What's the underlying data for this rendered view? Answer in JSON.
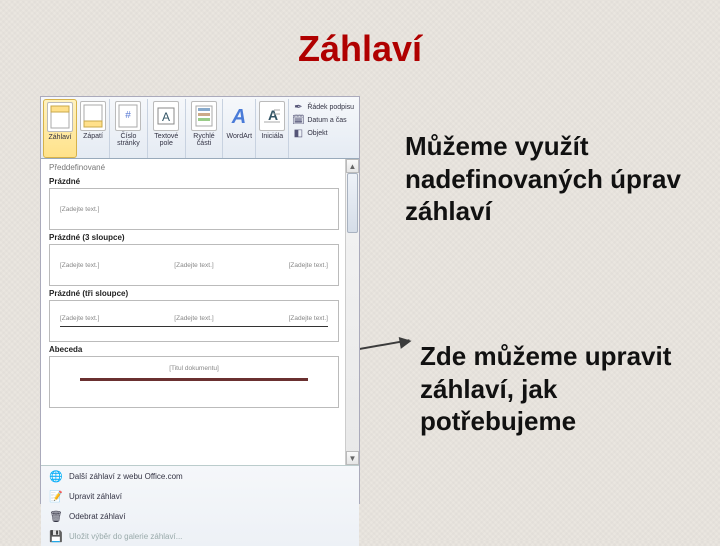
{
  "slide": {
    "title": "Záhlaví",
    "text1": "Můžeme využít nadefinovaných úprav záhlaví",
    "text2": "Zde můžeme upravit záhlaví, jak potřebujeme"
  },
  "ribbon": {
    "zahlavi": "Záhlaví",
    "zapati": "Zápatí",
    "cislo_stranky": "Číslo stránky",
    "textove_pole": "Textové pole",
    "rychle_casti": "Rychlé části",
    "wordart": "WordArt",
    "inicialy": "Iniciála",
    "radek_podpisu": "Řádek podpisu",
    "datum_cas": "Datum a čas",
    "objekt": "Objekt"
  },
  "gallery": {
    "section": "Předdefinované",
    "presets": [
      {
        "name": "Prázdné",
        "placeholders": [
          "[Zadejte text.]"
        ]
      },
      {
        "name": "Prázdné (3 sloupce)",
        "placeholders": [
          "[Zadejte text.]",
          "[Zadejte text.]",
          "[Zadejte text.]"
        ]
      },
      {
        "name": "Prázdné (tři sloupce)",
        "placeholders": [
          "[Zadejte text.]",
          "[Zadejte text.]",
          "[Zadejte text.]"
        ]
      },
      {
        "name": "Abeceda",
        "placeholders": [
          "[Titul dokumentu]"
        ]
      }
    ]
  },
  "footer": {
    "more_web": "Další záhlaví z webu Office.com",
    "edit": "Upravit záhlaví",
    "remove": "Odebrat záhlaví",
    "save_gallery": "Uložit výběr do galerie záhlaví..."
  }
}
